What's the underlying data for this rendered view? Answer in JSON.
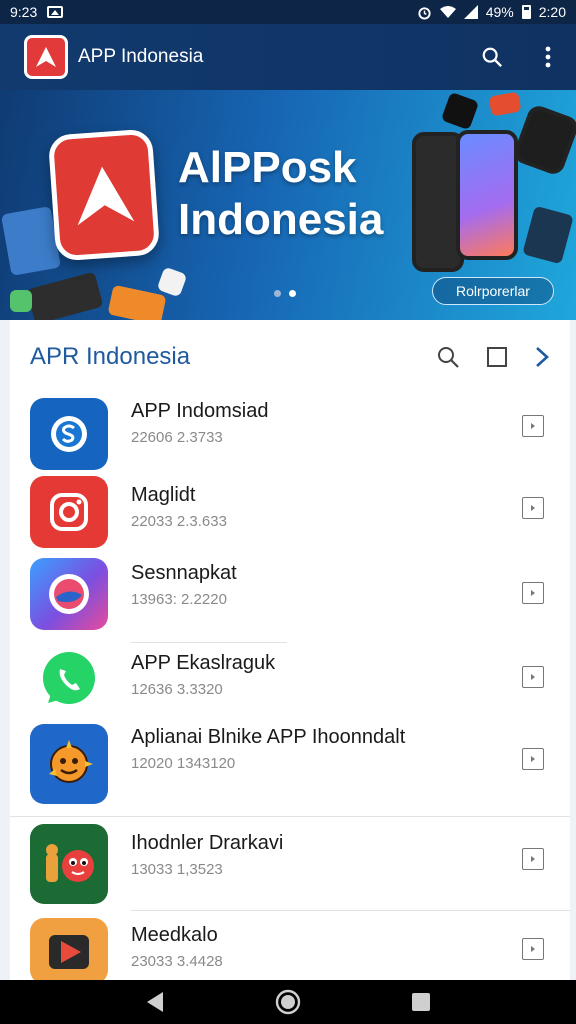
{
  "status_bar": {
    "time": "9:23",
    "battery": "49%",
    "clock_right": "2:20"
  },
  "app_bar": {
    "title": "APP Indonesia"
  },
  "banner": {
    "headline": "AlPPosk\nIndonesia",
    "button_label": "Rolrporerlar",
    "slide_index": 2,
    "slide_count": 2
  },
  "list": {
    "title": "APR Indonesia",
    "items": [
      {
        "name": "APP Indomsiad",
        "meta": "22606 2.3733",
        "icon": "skype-icon",
        "color": "#1565c0"
      },
      {
        "name": "Maglidt",
        "meta": "22033 2.3.633",
        "icon": "camera-icon",
        "color": "#e53935"
      },
      {
        "name": "Sesnnapkat",
        "meta": "13963: 2.2220",
        "icon": "circle-app-icon",
        "color": "#7b4fe0"
      },
      {
        "name": "APP Ekaslraguk",
        "meta": "12636 3.3320",
        "icon": "whatsapp-icon",
        "color": "#25d366"
      },
      {
        "name": "Aplianai Blnike APP Ihoonndalt",
        "meta": "12020 1343120",
        "icon": "sun-character-icon",
        "color": "#1f67c9"
      },
      {
        "name": "Ihodnler Drarkavi",
        "meta": "13033 1,3523",
        "icon": "creature-icon",
        "color": "#1c6b34"
      },
      {
        "name": "Meedkalo",
        "meta": "23033 3.4428",
        "icon": "play-store-icon",
        "color": "#f0a040"
      }
    ]
  },
  "nav_bar": {
    "items": [
      "back-icon",
      "home-icon",
      "recents-icon"
    ]
  }
}
